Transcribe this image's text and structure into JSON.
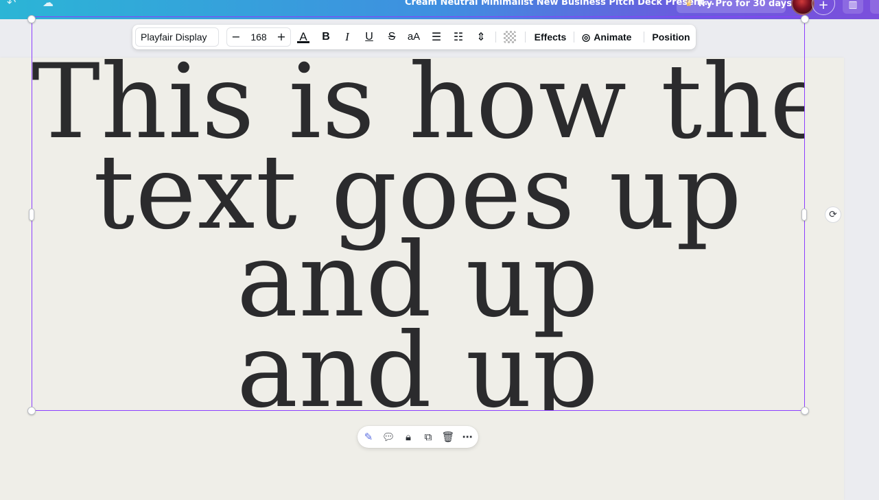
{
  "topbar": {
    "doc_title": "Cream Neutral Minimalist New Business Pitch Deck Present...",
    "try_pro_label": "Try Pro for 30 days",
    "plus_label": "+"
  },
  "text_toolbar": {
    "font_family": "Playfair Display",
    "font_size": "168",
    "minus": "−",
    "plus": "+",
    "effects_label": "Effects",
    "animate_label": "Animate",
    "position_label": "Position"
  },
  "canvas": {
    "lines": [
      "This is how the",
      "text goes up",
      "and up",
      "and up"
    ]
  },
  "colors": {
    "accent": "#8b3dff",
    "text": "#2b2b2d",
    "page": "#efeee8"
  }
}
